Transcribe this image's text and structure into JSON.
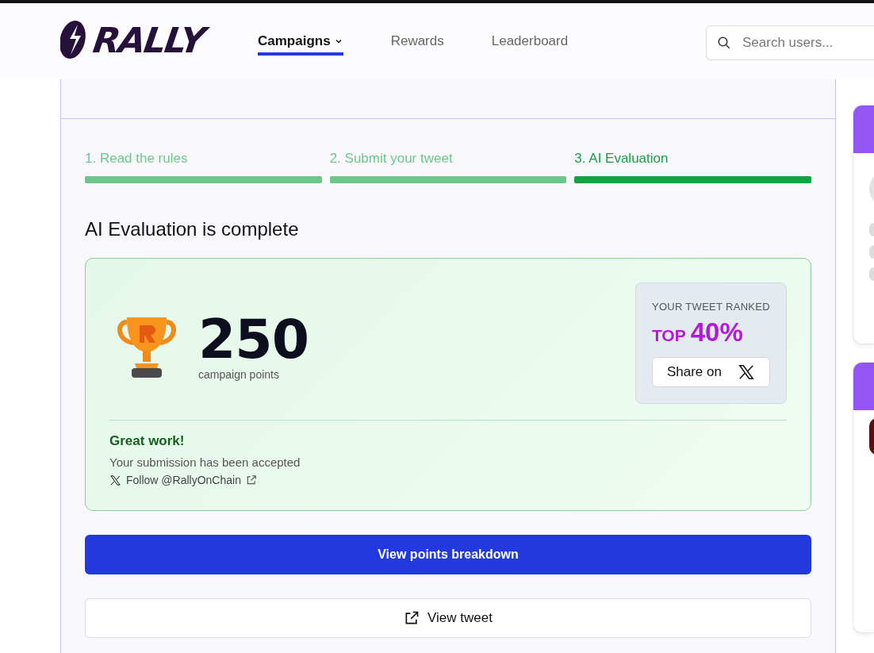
{
  "header": {
    "logo": "RALLY",
    "nav": [
      {
        "label": "Campaigns",
        "selected": true,
        "dropdown": true
      },
      {
        "label": "Rewards",
        "selected": false,
        "dropdown": false
      },
      {
        "label": "Leaderboard",
        "selected": false,
        "dropdown": false
      }
    ],
    "search": {
      "placeholder": "Search users..."
    }
  },
  "steps": [
    {
      "label": "1. Read the rules",
      "current": false
    },
    {
      "label": "2. Submit your tweet",
      "current": false
    },
    {
      "label": "3. AI Evaluation",
      "current": true
    }
  ],
  "title": "AI Evaluation is complete",
  "result": {
    "points": "250",
    "points_label": "campaign points",
    "rank_caption": "YOUR TWEET RANKED",
    "rank_prefix": "TOP",
    "rank_value": "40%",
    "share_label": "Share on",
    "message_title": "Great work!",
    "message": "Your submission has been accepted",
    "follow": "Follow @RallyOnChain"
  },
  "buttons": [
    {
      "label": "View points breakdown",
      "kind": "primary"
    },
    {
      "label": "View tweet",
      "kind": "secondary"
    }
  ],
  "side_cards": [
    {
      "kind": "loading"
    },
    {
      "kind": "post"
    }
  ]
}
